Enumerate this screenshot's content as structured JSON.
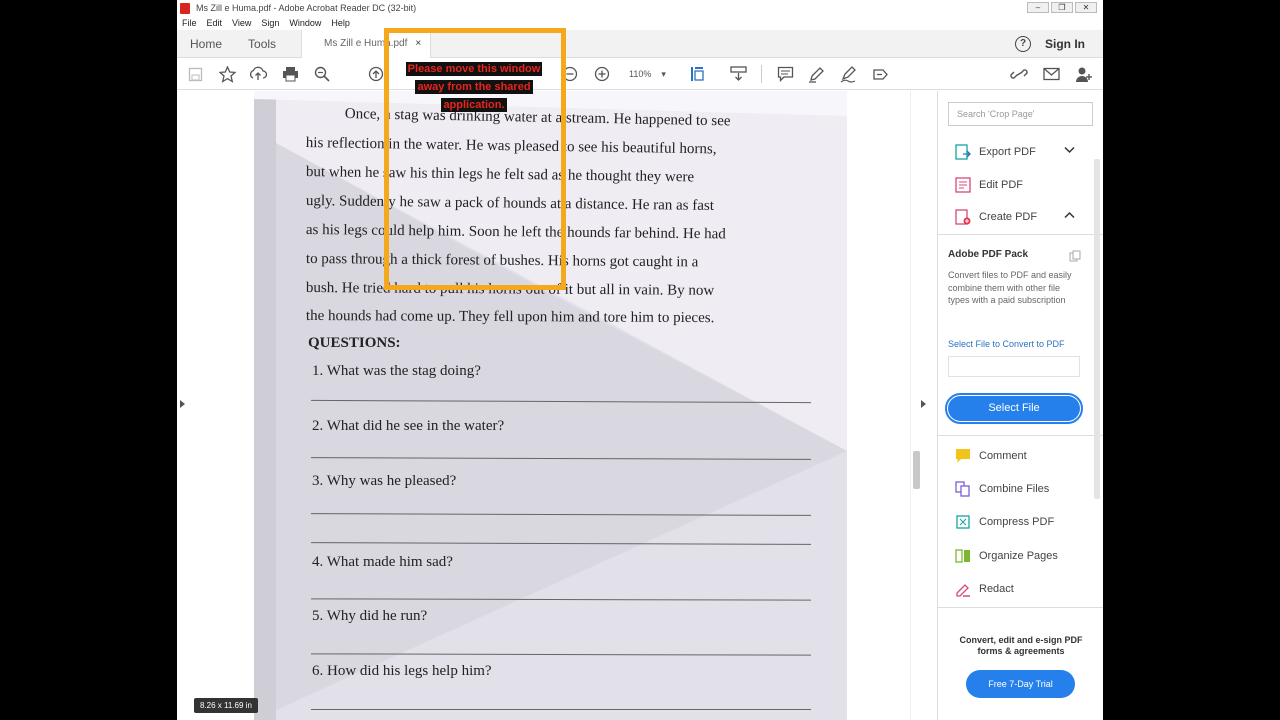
{
  "window": {
    "title": "Ms Zill e Huma.pdf - Adobe Acrobat Reader DC (32-bit)"
  },
  "menu": [
    "File",
    "Edit",
    "View",
    "Sign",
    "Window",
    "Help"
  ],
  "tabs": {
    "home": "Home",
    "tools": "Tools",
    "doc": "Ms Zill e Huma.pdf",
    "close": "×",
    "sign_in": "Sign In",
    "help": "?"
  },
  "toolbar": {
    "zoom": "110%"
  },
  "overlay": {
    "line1": "Please move this window",
    "line2": "away from the shared",
    "line3": "application."
  },
  "document": {
    "paragraph": [
      "Once, a stag was drinking water at a stream. He happened to see",
      "his reflection in the water. He was pleased to see his beautiful horns,",
      "but when he saw his thin legs he felt sad as he thought they were",
      "ugly. Suddenly he saw a pack of hounds at a distance. He ran as fast",
      "as his legs could help him. Soon he left the hounds far behind. He had",
      "to pass through a thick forest of bushes. His horns got caught in a",
      "bush. He tried hard to pull his horns out of it but all in vain. By now",
      "the hounds had come up. They fell upon him and tore him to pieces."
    ],
    "questions_heading": "QUESTIONS:",
    "questions": [
      "1. What was the stag doing?",
      "2. What did he see in the water?",
      "3. Why was he pleased?",
      "4. What made him sad?",
      "5. Why did he run?",
      "6. How did his legs help him?"
    ],
    "page_size": "8.26 x 11.69 in"
  },
  "right_pane": {
    "search_placeholder": "Search 'Crop Page'",
    "export_pdf": "Export PDF",
    "edit_pdf": "Edit PDF",
    "create_pdf": "Create PDF",
    "pack_title": "Adobe PDF Pack",
    "pack_desc": "Convert files to PDF and easily combine them with other file types with a paid subscription",
    "select_file_link": "Select File to Convert to PDF",
    "select_file_button": "Select File",
    "comment": "Comment",
    "combine_files": "Combine Files",
    "compress_pdf": "Compress PDF",
    "organize_pages": "Organize Pages",
    "redact": "Redact",
    "promo_text": "Convert, edit and e-sign PDF forms & agreements",
    "trial_button": "Free 7-Day Trial"
  },
  "colors": {
    "accent_blue": "#2680eb",
    "share_frame": "#f5a81c",
    "share_text": "#e8241c"
  }
}
